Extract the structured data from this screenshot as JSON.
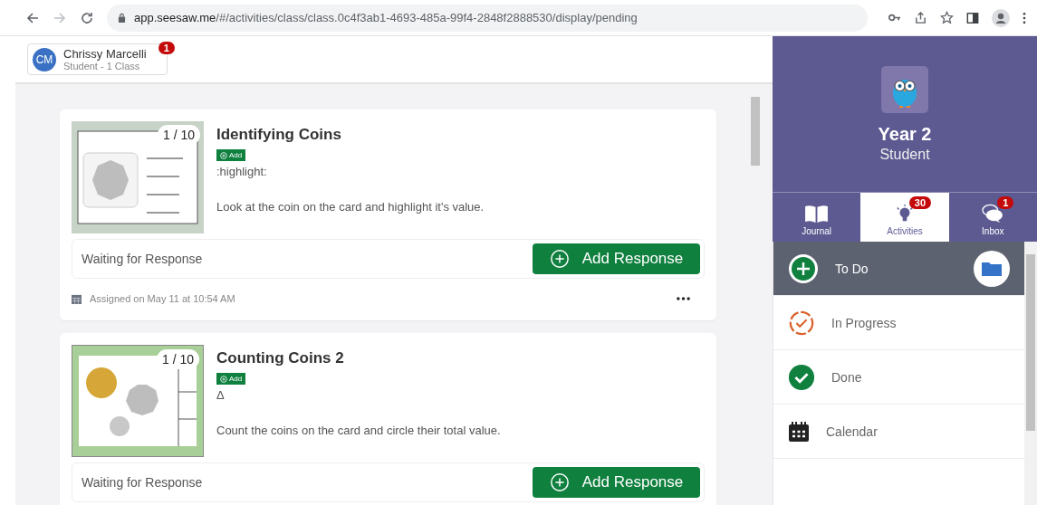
{
  "browser": {
    "nav": [
      {
        "kind": "back",
        "disabled": false
      },
      {
        "kind": "forward",
        "disabled": true
      },
      {
        "kind": "reload",
        "disabled": false
      }
    ],
    "url_host": "app.seesaw.me",
    "url_path": "/#/activities/class/class.0c4f3ab1-4693-485a-99f4-2848f2888530/display/pending"
  },
  "user": {
    "initials": "CM",
    "name": "Chrissy Marcelli",
    "subtitle": "Student - 1 Class",
    "badge": "1"
  },
  "activities": [
    {
      "kind": "worksheet",
      "counter": "1 / 10",
      "title": "Identifying Coins",
      "add_label": "Add",
      "prompt": ":highlight:",
      "description": "Look at the coin on the card and highlight it's value.",
      "status": "Waiting for Response",
      "button": "Add Response",
      "assigned": "Assigned on May 11 at 10:54 AM"
    },
    {
      "kind": "coins",
      "counter": "1 / 10",
      "title": "Counting Coins 2",
      "add_label": "Add",
      "prompt": "Δ",
      "description": "Count the coins on the card and circle their total value.",
      "status": "Waiting for Response",
      "button": "Add Response"
    }
  ],
  "sidebar": {
    "class_name": "Year 2",
    "role": "Student",
    "tabs": [
      {
        "kind": "journal",
        "label": "Journal",
        "selected": false
      },
      {
        "kind": "activities",
        "label": "Activities",
        "badge": "30",
        "selected": true
      },
      {
        "kind": "inbox",
        "label": "Inbox",
        "badge": "1",
        "selected": false
      }
    ],
    "items": [
      {
        "kind": "todo",
        "label": "To Do",
        "selected": true
      },
      {
        "kind": "progress",
        "label": "In Progress",
        "selected": false
      },
      {
        "kind": "done",
        "label": "Done",
        "selected": false
      },
      {
        "kind": "calendar",
        "label": "Calendar",
        "selected": false
      }
    ]
  }
}
